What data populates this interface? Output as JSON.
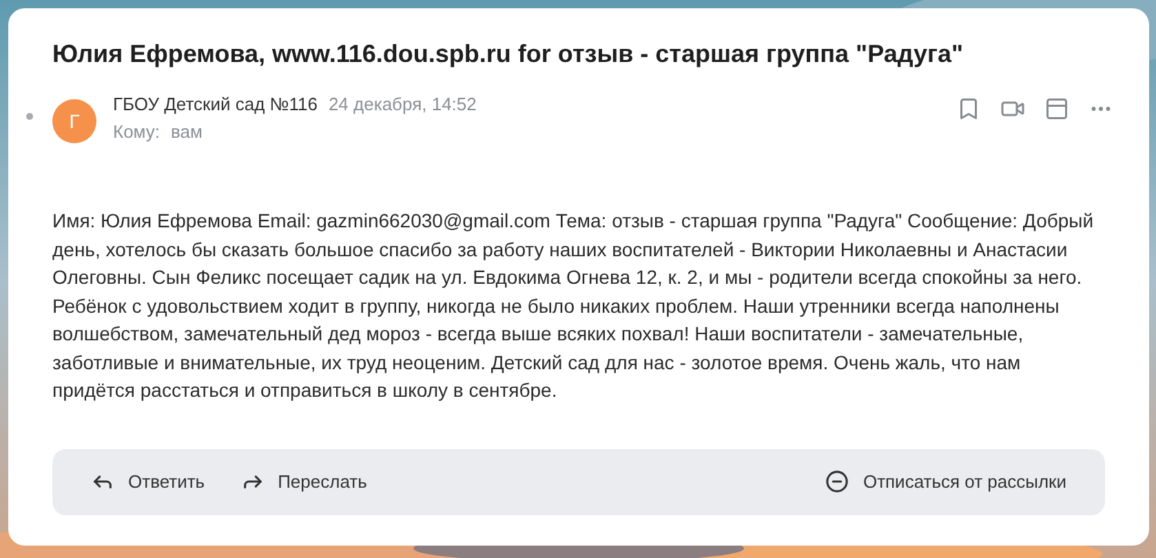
{
  "message": {
    "subject": "Юлия Ефремова, www.116.dou.spb.ru for отзыв - старшая группа \"Радуга\"",
    "unread": true,
    "sender": {
      "initial": "Г",
      "name": "ГБОУ Детский сад №116",
      "date": "24 декабря, 14:52"
    },
    "recipient": {
      "label": "Кому:",
      "value": "вам"
    },
    "body": "Имя: Юлия Ефремова Email: gazmin662030@gmail.com Тема: отзыв - старшая группа \"Радуга\" Сообщение: Добрый день, хотелось бы сказать большое спасибо за работу наших воспитателей - Виктории Николаевны и Анастасии Олеговны. Сын Феликс посещает садик на ул. Евдокима Огнева 12, к. 2, и мы - родители всегда спокойны за него. Ребёнок с удовольствием ходит в группу, никогда не было никаких проблем. Наши утренники всегда наполнены волшебством, замечательный дед мороз - всегда выше всяких похвал! Наши воспитатели - замечательные, заботливые и внимательные, их труд неоценим. Детский сад для нас - золотое время. Очень жаль, что нам придётся расстаться и отправиться в школу в сентябре."
  },
  "actions": [
    {
      "kind": "reply",
      "label": "Ответить"
    },
    {
      "kind": "forward",
      "label": "Переслать"
    },
    {
      "kind": "unsubscribe",
      "label": "Отписаться от рассылки"
    }
  ]
}
